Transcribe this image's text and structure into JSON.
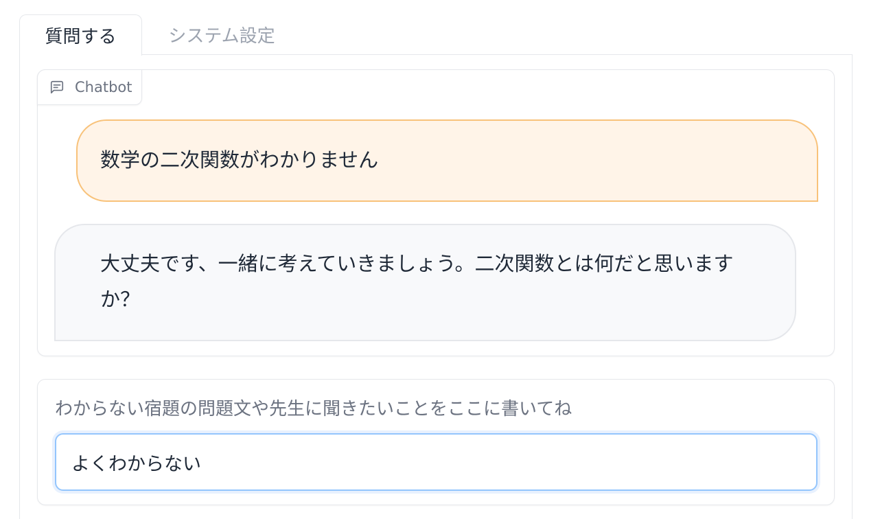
{
  "tabs": [
    {
      "label": "質問する",
      "active": true
    },
    {
      "label": "システム設定",
      "active": false
    }
  ],
  "chatbot": {
    "label": "Chatbot",
    "label_icon": "chat-bubble-icon",
    "messages": [
      {
        "role": "user",
        "text": "数学の二次関数がわかりません"
      },
      {
        "role": "bot",
        "text": "大丈夫です、一緒に考えていきましょう。二次関数とは何だと思いますか？"
      }
    ]
  },
  "input": {
    "label": "わからない宿題の問題文や先生に聞きたいことをここに書いてね",
    "value": "よくわからない"
  },
  "colors": {
    "user_bubble_bg": "#fff4e8",
    "user_bubble_border": "#f8c27a",
    "bot_bubble_bg": "#f8f9fb",
    "input_focus_border": "#93c5fd"
  }
}
